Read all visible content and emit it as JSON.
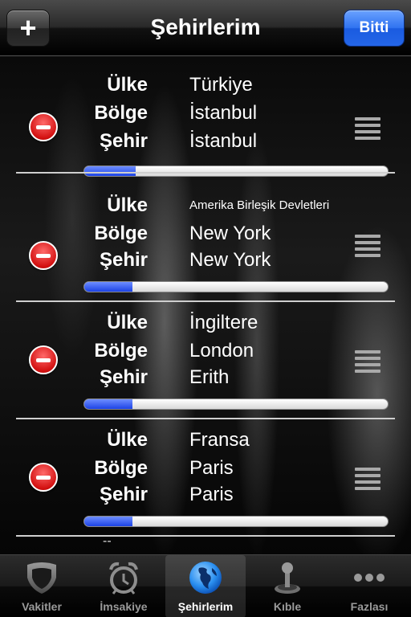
{
  "header": {
    "title": "Şehirlerim",
    "add_label": "+",
    "done_label": "Bitti"
  },
  "labels": {
    "country": "Ülke",
    "region": "Bölge",
    "city": "Şehir"
  },
  "cities": [
    {
      "country": "Türkiye",
      "region": "İstanbul",
      "city": "İstanbul",
      "progress": 0.17
    },
    {
      "country": "Amerika Birleşik Devletleri",
      "region": "New York",
      "city": "New York",
      "progress": 0.16
    },
    {
      "country": "İngiltere",
      "region": "London",
      "city": "Erith",
      "progress": 0.16
    },
    {
      "country": "Fransa",
      "region": "Paris",
      "city": "Paris",
      "progress": 0.16
    }
  ],
  "partial_row_text": "--",
  "tabs": [
    {
      "label": "Vakitler",
      "icon": "shield-icon"
    },
    {
      "label": "İmsakiye",
      "icon": "alarm-clock-icon"
    },
    {
      "label": "Şehirlerim",
      "icon": "globe-icon",
      "active": true
    },
    {
      "label": "Kıble",
      "icon": "joystick-icon"
    },
    {
      "label": "Fazlası",
      "icon": "more-dots-icon"
    }
  ],
  "colors": {
    "done_button": "#2f72f0",
    "progress_fill": "#1c43e6",
    "delete_button": "#d41212"
  }
}
